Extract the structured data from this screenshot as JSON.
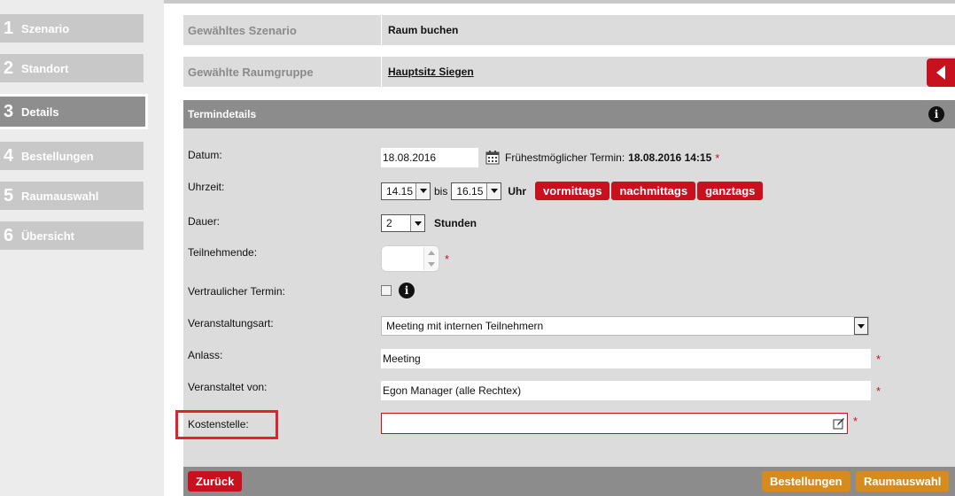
{
  "steps": [
    {
      "num": "1",
      "label": "Szenario"
    },
    {
      "num": "2",
      "label": "Standort"
    },
    {
      "num": "3",
      "label": "Details"
    },
    {
      "num": "4",
      "label": "Bestellungen"
    },
    {
      "num": "5",
      "label": "Raumauswahl"
    },
    {
      "num": "6",
      "label": "Übersicht"
    }
  ],
  "active_step": "3",
  "summary": {
    "scenario_label": "Gewähltes Szenario",
    "scenario_value": "Raum buchen",
    "roomgroup_label": "Gewählte Raumgruppe",
    "roomgroup_value": "Hauptsitz Siegen"
  },
  "details": {
    "title": "Termindetails",
    "date_label": "Datum:",
    "date_value": "18.08.2016",
    "earliest_label": "Frühestmöglicher Termin:",
    "earliest_value": "18.08.2016 14:15",
    "time_label": "Uhrzeit:",
    "time_from": "14.15",
    "time_sep": "bis",
    "time_to": "16.15",
    "time_unit": "Uhr",
    "btn_morning": "vormittags",
    "btn_afternoon": "nachmittags",
    "btn_allday": "ganztags",
    "duration_label": "Dauer:",
    "duration_value": "2",
    "duration_unit": "Stunden",
    "participants_label": "Teilnehmende:",
    "participants_value": "",
    "confidential_label": "Vertraulicher Termin:",
    "confidential_checked": false,
    "eventtype_label": "Veranstaltungsart:",
    "eventtype_value": "Meeting mit internen Teilnehmern",
    "occasion_label": "Anlass:",
    "occasion_value": "Meeting",
    "organizer_label": "Veranstaltet von:",
    "organizer_value": "Egon Manager (alle Rechtex)",
    "costcenter_label": "Kostenstelle:",
    "costcenter_value": "",
    "required_mark": "*"
  },
  "footer": {
    "back": "Zurück",
    "orders": "Bestellungen",
    "roomselect": "Raumauswahl"
  },
  "colors": {
    "accent": "#c8101e",
    "orange": "#d58b1e",
    "highlight": "#e5202e"
  }
}
